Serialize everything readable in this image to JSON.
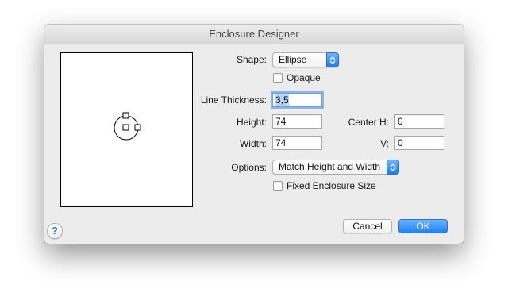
{
  "window": {
    "title": "Enclosure Designer"
  },
  "shape": {
    "label": "Shape:",
    "value": "Ellipse"
  },
  "opaque": {
    "label": "Opaque",
    "checked": false
  },
  "line_thickness": {
    "label": "Line Thickness:",
    "value": "3,5"
  },
  "height": {
    "label": "Height:",
    "value": "74"
  },
  "width": {
    "label": "Width:",
    "value": "74"
  },
  "center_h": {
    "label": "Center H:",
    "value": "0"
  },
  "center_v": {
    "label": "V:",
    "value": "0"
  },
  "options": {
    "label": "Options:",
    "value": "Match Height and Width"
  },
  "fixed_size": {
    "label": "Fixed Enclosure Size",
    "checked": false
  },
  "buttons": {
    "help": "?",
    "cancel": "Cancel",
    "ok": "OK"
  },
  "colors": {
    "accent": "#1b82f3",
    "window_bg": "#ececec"
  }
}
